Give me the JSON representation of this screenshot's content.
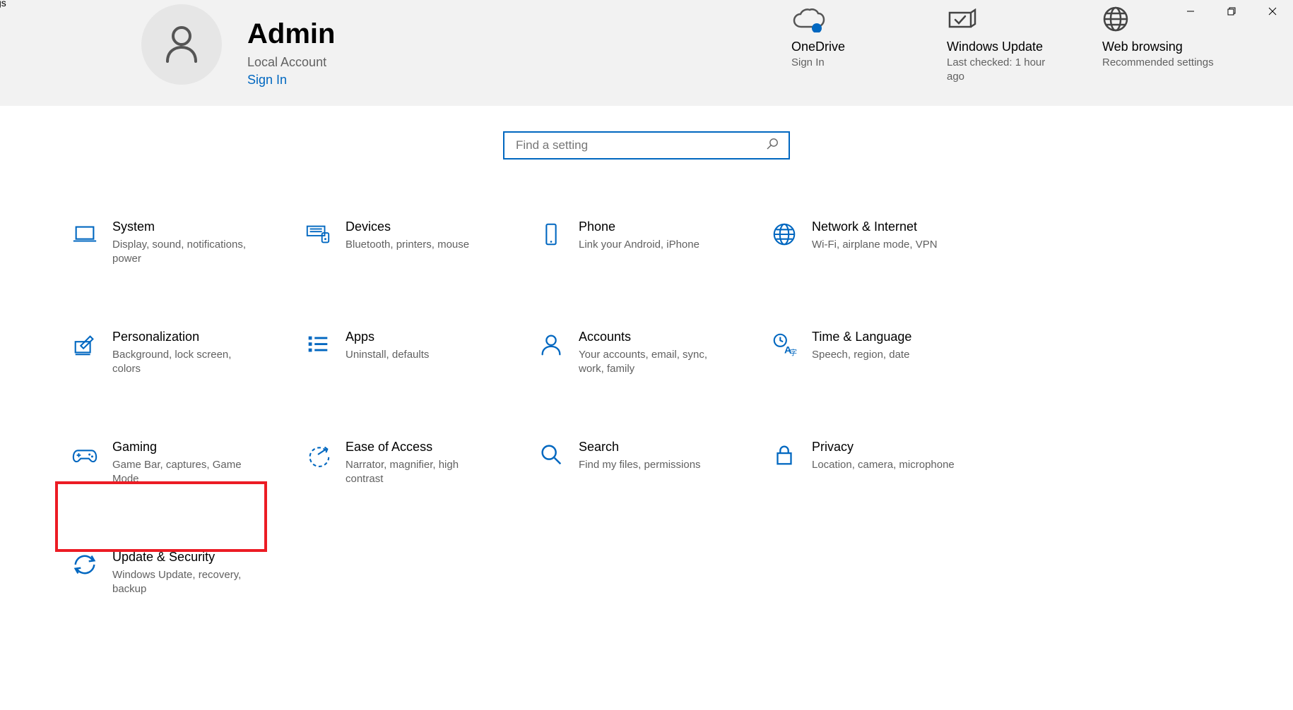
{
  "window": {
    "fragment_title": "gs"
  },
  "user": {
    "name": "Admin",
    "account_type": "Local Account",
    "signin_label": "Sign In"
  },
  "status_cards": [
    {
      "id": "onedrive",
      "title": "OneDrive",
      "subtitle": "Sign In"
    },
    {
      "id": "windows-update",
      "title": "Windows Update",
      "subtitle": "Last checked: 1 hour ago"
    },
    {
      "id": "web-browsing",
      "title": "Web browsing",
      "subtitle": "Recommended settings"
    }
  ],
  "search": {
    "placeholder": "Find a setting"
  },
  "categories": [
    {
      "id": "system",
      "title": "System",
      "desc": "Display, sound, notifications, power"
    },
    {
      "id": "devices",
      "title": "Devices",
      "desc": "Bluetooth, printers, mouse"
    },
    {
      "id": "phone",
      "title": "Phone",
      "desc": "Link your Android, iPhone"
    },
    {
      "id": "network",
      "title": "Network & Internet",
      "desc": "Wi-Fi, airplane mode, VPN"
    },
    {
      "id": "personalization",
      "title": "Personalization",
      "desc": "Background, lock screen, colors"
    },
    {
      "id": "apps",
      "title": "Apps",
      "desc": "Uninstall, defaults"
    },
    {
      "id": "accounts",
      "title": "Accounts",
      "desc": "Your accounts, email, sync, work, family"
    },
    {
      "id": "time-language",
      "title": "Time & Language",
      "desc": "Speech, region, date"
    },
    {
      "id": "gaming",
      "title": "Gaming",
      "desc": "Game Bar, captures, Game Mode"
    },
    {
      "id": "ease-of-access",
      "title": "Ease of Access",
      "desc": "Narrator, magnifier, high contrast"
    },
    {
      "id": "search",
      "title": "Search",
      "desc": "Find my files, permissions"
    },
    {
      "id": "privacy",
      "title": "Privacy",
      "desc": "Location, camera, microphone"
    },
    {
      "id": "update-security",
      "title": "Update & Security",
      "desc": "Windows Update, recovery, backup"
    }
  ],
  "highlighted_category": "update-security",
  "colors": {
    "accent": "#0067c0",
    "highlight": "#ec1c24"
  }
}
